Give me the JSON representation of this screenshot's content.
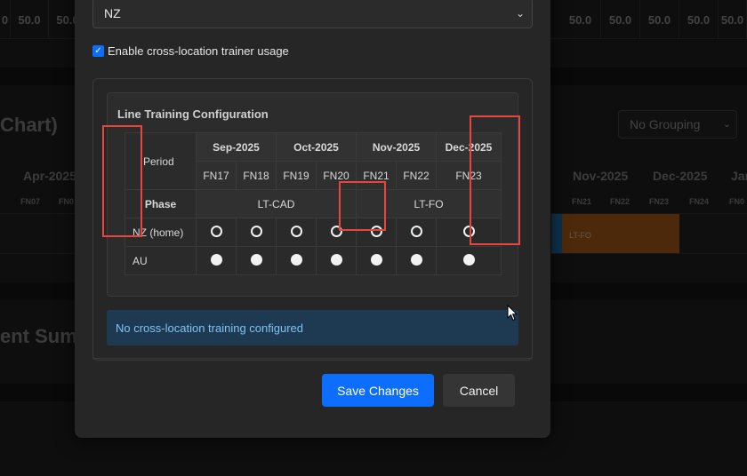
{
  "background": {
    "top_values": [
      "0",
      "50.0",
      "50.0",
      "50.0",
      "50.0",
      "50.0",
      "50.0",
      "50.0",
      "50.0",
      "50.0"
    ],
    "chart_title": "Chart)",
    "summary_title": "ent Sum",
    "grouping_select": "No Grouping",
    "months_left": [
      "Apr-2025"
    ],
    "months_right": [
      "Nov-2025",
      "Dec-2025",
      "Jan"
    ],
    "fn_left": [
      "FN07",
      "FN0"
    ],
    "fn_right": [
      "FN21",
      "FN22",
      "FN23",
      "FN24",
      "FN0"
    ],
    "bar_label": "LT-FO",
    "colors": {
      "bar_orange": "#8a4c14",
      "bar_blue": "#1c5a8a"
    }
  },
  "modal": {
    "location_select": "NZ",
    "cross_location_label": "Enable cross-location trainer usage",
    "cross_location_checked": true,
    "config_title": "Line Training Configuration",
    "table": {
      "period_label": "Period",
      "months": [
        "Sep-2025",
        "Oct-2025",
        "Nov-2025",
        "Dec-2025"
      ],
      "fortnights": [
        "FN17",
        "FN18",
        "FN19",
        "FN20",
        "FN21",
        "FN22",
        "FN23"
      ],
      "phase_label": "Phase",
      "phases": [
        "LT-CAD",
        "LT-FO"
      ],
      "locations": [
        {
          "name": "NZ (home)",
          "selection": [
            "empty",
            "empty",
            "empty",
            "empty",
            "empty",
            "empty",
            "empty"
          ]
        },
        {
          "name": "AU",
          "selection": [
            "filled",
            "filled",
            "filled",
            "filled",
            "filled",
            "filled",
            "filled"
          ]
        }
      ]
    },
    "info_message": "No cross-location training configured",
    "save_label": "Save Changes",
    "cancel_label": "Cancel"
  },
  "colors": {
    "accent": "#0d6efd",
    "info_bg": "#1e3a52",
    "info_text": "#7ec3f2",
    "highlight": "#e8463c"
  }
}
